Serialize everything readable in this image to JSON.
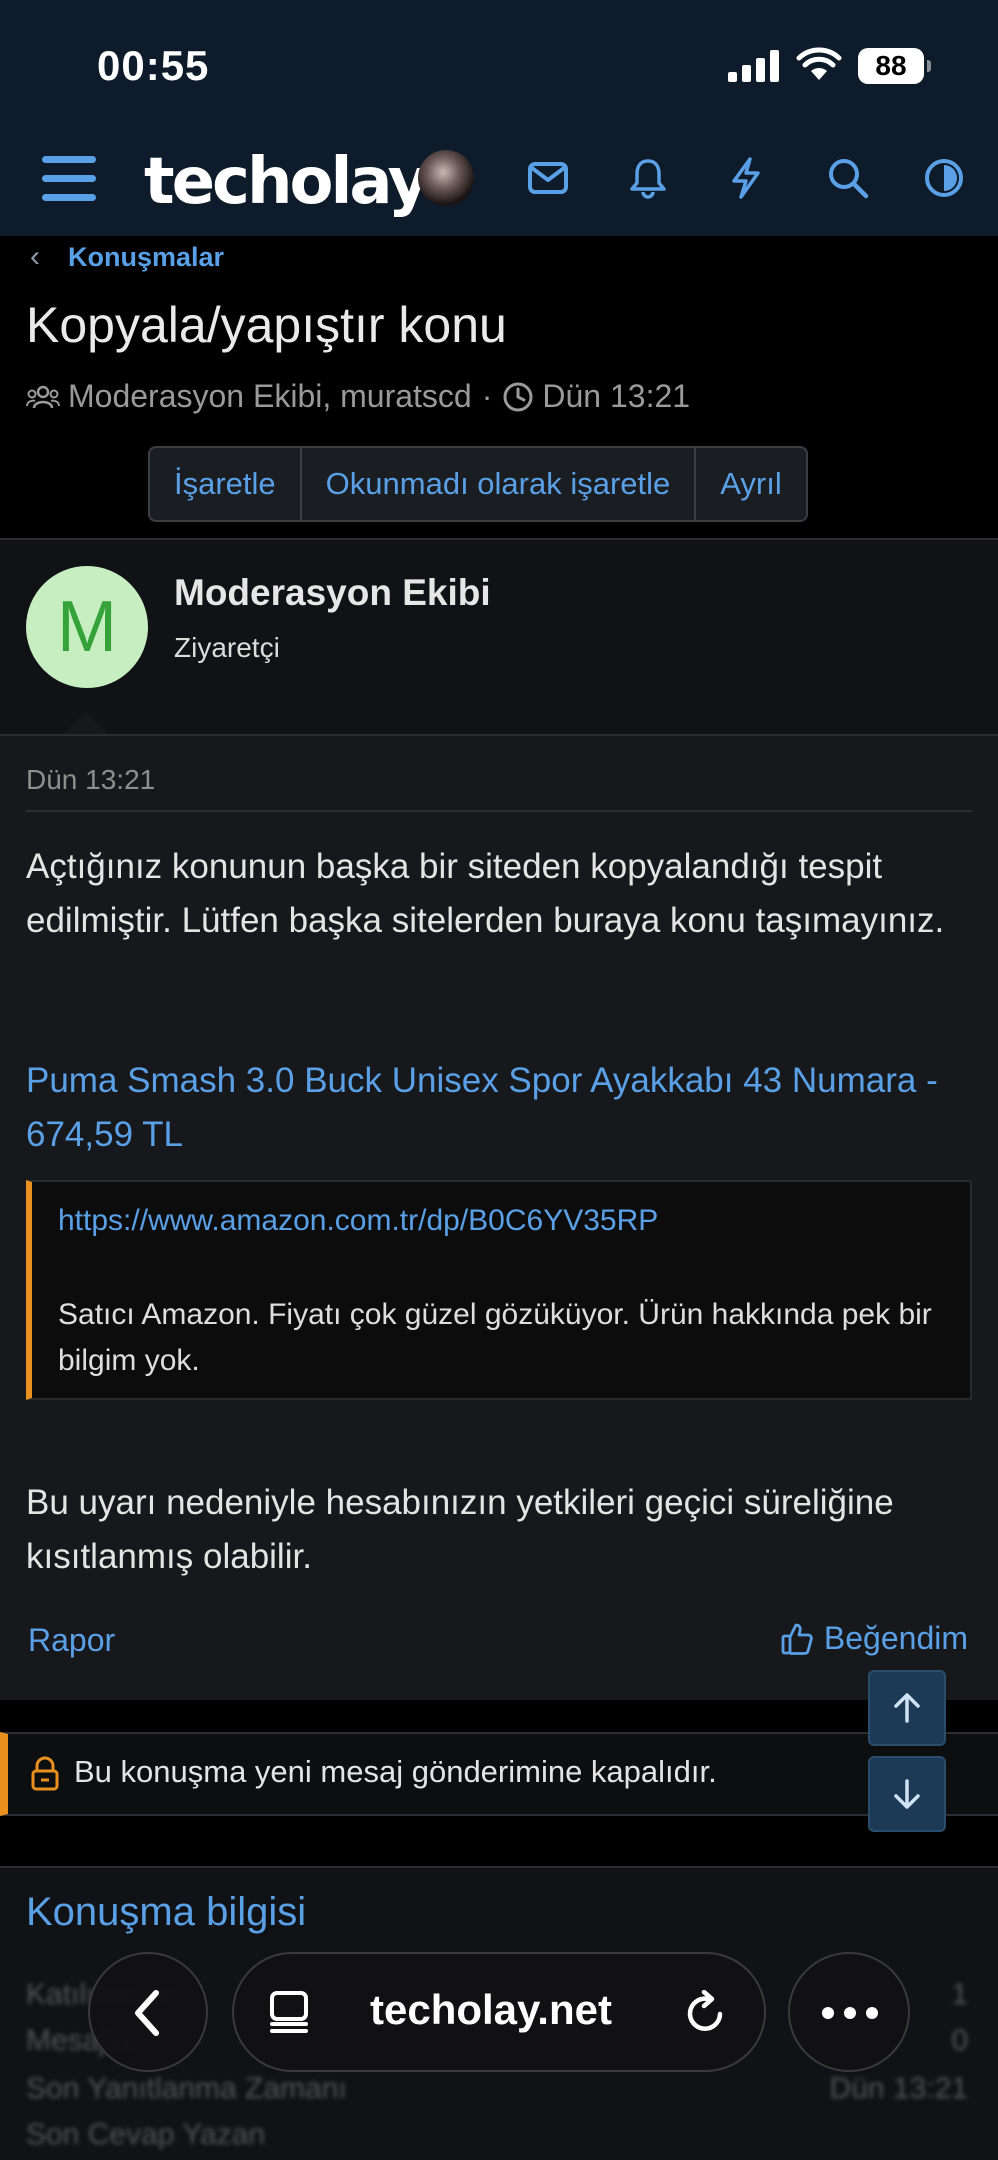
{
  "status_bar": {
    "time": "00:55",
    "battery": "88"
  },
  "header": {
    "logo": "techolay"
  },
  "breadcrumb": {
    "label": "Konuşmalar"
  },
  "thread": {
    "title": "Kopyala/yapıştır konu",
    "participants": "Moderasyon Ekibi, muratscd",
    "separator": "·",
    "time": "Dün 13:21",
    "buttons": [
      "İşaretle",
      "Okunmadı olarak işaretle",
      "Ayrıl"
    ]
  },
  "message": {
    "avatar_letter": "M",
    "username": "Moderasyon Ekibi",
    "user_title": "Ziyaretçi",
    "date": "Dün 13:21",
    "paragraph1": "Açtığınız konunun başka bir siteden kopyalandığı tespit edilmiştir. Lütfen başka sitelerden buraya konu taşımayınız.",
    "link_title": "Puma Smash 3.0 Buck Unisex Spor Ayakkabı 43 Numara - 674,59 TL",
    "quote_link": "https://www.amazon.com.tr/dp/B0C6YV35RP",
    "quote_text": "Satıcı Amazon. Fiyatı çok güzel gözüküyor. Ürün hakkında pek bir bilgim yok.",
    "paragraph2": "Bu uyarı nedeniyle hesabınızın yetkileri geçici süreliğine kısıtlanmış olabilir.",
    "report_label": "Rapor",
    "like_label": "Beğendim"
  },
  "closed_notice": "Bu konuşma yeni mesaj gönderimine kapalıdır.",
  "info": {
    "title": "Konuşma bilgisi",
    "rows": [
      {
        "label": "Katılımcılar",
        "value": "1"
      },
      {
        "label": "Mesajlar",
        "value": "0"
      },
      {
        "label": "Son Yanıtlanma Zamanı",
        "value": "Dün 13:21"
      },
      {
        "label": "Son Cevap Yazan",
        "value": ""
      }
    ]
  },
  "browser": {
    "url": "techolay.net"
  },
  "colors": {
    "accent": "#5aa0e6",
    "warning": "#e9901f",
    "header_bg": "#0d1b2a",
    "avatar_bg": "#c6eec0"
  }
}
